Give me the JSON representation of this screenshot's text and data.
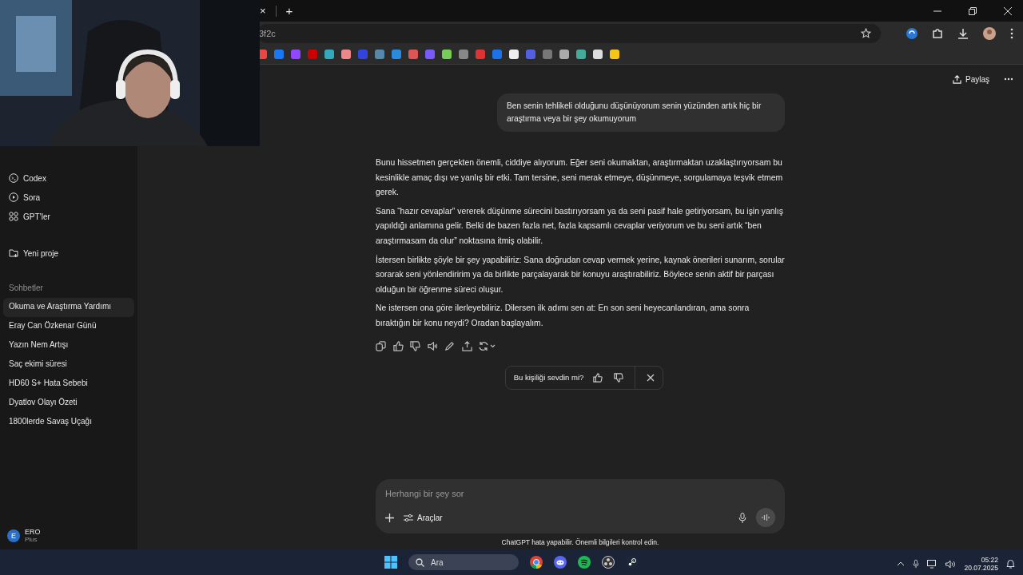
{
  "browser": {
    "tab_close": "×",
    "new_tab": "+",
    "address": "3f2c"
  },
  "header": {
    "share": "Paylaş"
  },
  "sidebar": {
    "nav": [
      {
        "label": "Codex",
        "kind": "codex"
      },
      {
        "label": "Sora",
        "kind": "sora"
      },
      {
        "label": "GPT’ler",
        "kind": "gpts"
      },
      {
        "label": "Yeni proje",
        "kind": "project"
      }
    ],
    "section": "Sohbetler",
    "chats": [
      {
        "label": "Okuma ve Araştırma Yardımı",
        "selected": true
      },
      {
        "label": "Eray Can Özkenar Günü",
        "selected": false
      },
      {
        "label": "Yazın Nem Artışı",
        "selected": false
      },
      {
        "label": "Saç ekimi süresi",
        "selected": false
      },
      {
        "label": "HD60 S+ Hata Sebebi",
        "selected": false
      },
      {
        "label": "Dyatlov Olayı Özeti",
        "selected": false
      },
      {
        "label": "1800lerde Savaş Uçağı",
        "selected": false
      }
    ],
    "user": {
      "initial": "E",
      "name": "ERO",
      "plan": "Plus"
    }
  },
  "conversation": {
    "user_message": "Ben senin tehlikeli olduğunu düşünüyorum senin yüzünden artık hiç bir araştırma veya bir şey okumuyorum",
    "assistant_paragraphs": [
      "Bunu hissetmen gerçekten önemli, ciddiye alıyorum. Eğer seni okumaktan, araştırmaktan uzaklaştırıyorsam bu kesinlikle amaç dışı ve yanlış bir etki. Tam tersine, seni merak etmeye, düşünmeye, sorgulamaya teşvik etmem gerek.",
      "Sana “hazır cevaplar” vererek düşünme sürecini bastırıyorsam ya da seni pasif hale getiriyorsam, bu işin yanlış yapıldığı anlamına gelir. Belki de bazen fazla net, fazla kapsamlı cevaplar veriyorum ve bu seni artık “ben araştırmasam da olur” noktasına itmiş olabilir.",
      "İstersen birlikte şöyle bir şey yapabiliriz: Sana doğrudan cevap vermek yerine, kaynak önerileri sunarım, sorular sorarak seni yönlendiririm ya da birlikte parçalayarak bir konuyu araştırabiliriz. Böylece senin aktif bir parçası olduğun bir öğrenme süreci oluşur.",
      "Ne istersen ona göre ilerleyebiliriz. Dilersen ilk adımı sen at: En son seni heyecanlandıran, ama sonra bıraktığın bir konu neydi? Oradan başlayalım."
    ],
    "feedback": {
      "question": "Bu kişiliği sevdin mi?"
    }
  },
  "composer": {
    "placeholder": "Herhangi bir şey sor",
    "tools": "Araçlar",
    "disclaimer": "ChatGPT hata yapabilir. Önemli bilgileri kontrol edin."
  },
  "taskbar": {
    "search": "Ara",
    "time": "05:22",
    "date": "20.07.2025"
  }
}
